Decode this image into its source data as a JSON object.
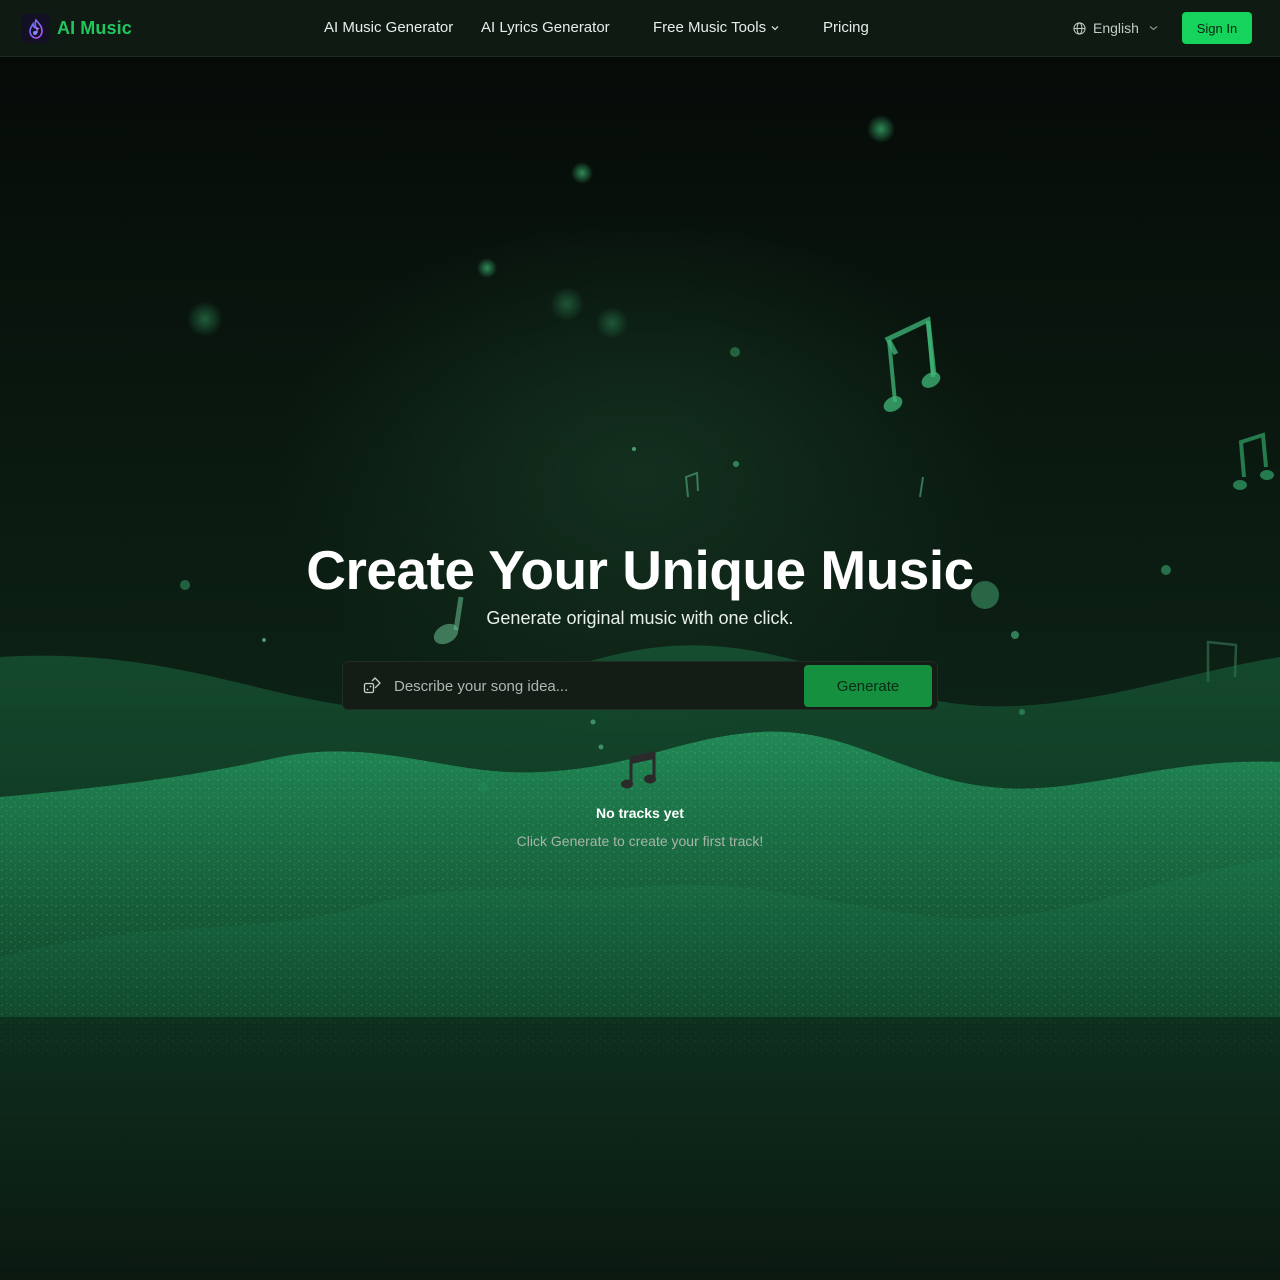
{
  "header": {
    "brand_name": "AI Music",
    "nav": {
      "music_generator": "AI Music Generator",
      "lyrics_generator": "AI Lyrics Generator",
      "free_tools": "Free Music Tools",
      "pricing": "Pricing"
    },
    "language": "English",
    "sign_in_label": "Sign In"
  },
  "hero": {
    "title": "Create Your Unique Music",
    "subtitle": "Generate original music with one click.",
    "prompt_placeholder": "Describe your song idea...",
    "generate_label": "Generate"
  },
  "tracks": {
    "empty_title": "No tracks yet",
    "empty_subtitle": "Click Generate to create your first track!"
  },
  "icons": {
    "logo": "music-flame-logo-icon",
    "chevron": "chevron-down-icon",
    "globe": "globe-icon",
    "prompt": "dice-sparkle-icon",
    "empty": "music-notes-icon"
  },
  "colors": {
    "accent": "#22c55e",
    "sign_in_bg": "#16d35b",
    "generate_bg": "#15903f",
    "background": "#0b150f"
  }
}
